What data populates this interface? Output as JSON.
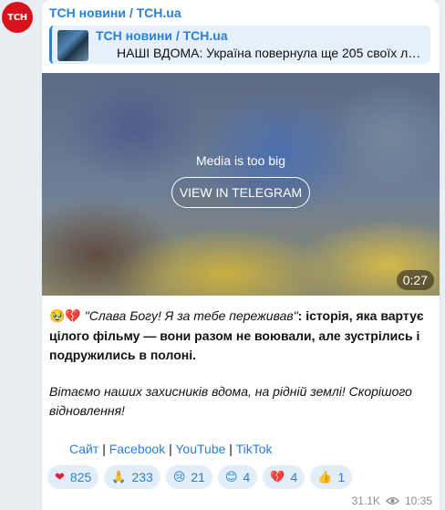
{
  "avatar": {
    "text": "ТСН"
  },
  "channel": {
    "name": "ТСН новини / TCH.ua"
  },
  "forwarded": {
    "title": "ТСН новини / TCH.ua",
    "text": "НАШІ ВДОМА: Україна повернула ще 205 своїх люд..."
  },
  "media": {
    "notice": "Media is too big",
    "button_label": "VIEW IN TELEGRAM",
    "duration": "0:27"
  },
  "post": {
    "p1_emojis": "🥹💔",
    "p1_quote": "\"Слава Богу! Я за тебе переживав\"",
    "p1_rest": ": історія, яка вартує цілого фільму — вони разом не воювали, але зустрілись і подружились в полоні.",
    "p2": "Вітаємо наших захисників вдома, на рідній землі! Скорішого відновлення!",
    "links": [
      "Сайт",
      "Facebook",
      "YouTube",
      "TikTok"
    ],
    "separator": "|"
  },
  "reactions": [
    {
      "emoji": "❤",
      "count": "825"
    },
    {
      "emoji": "🙏",
      "count": "233"
    },
    {
      "emoji": "😢",
      "count": "21"
    },
    {
      "emoji": "😊",
      "count": "4"
    },
    {
      "emoji": "💔",
      "count": "4"
    },
    {
      "emoji": "👍",
      "count": "1"
    }
  ],
  "meta": {
    "views": "31.1K",
    "time": "10:35"
  },
  "colors": {
    "accent": "#2a7fd6",
    "brand_red": "#d7141b",
    "heart": "#e0202f"
  }
}
